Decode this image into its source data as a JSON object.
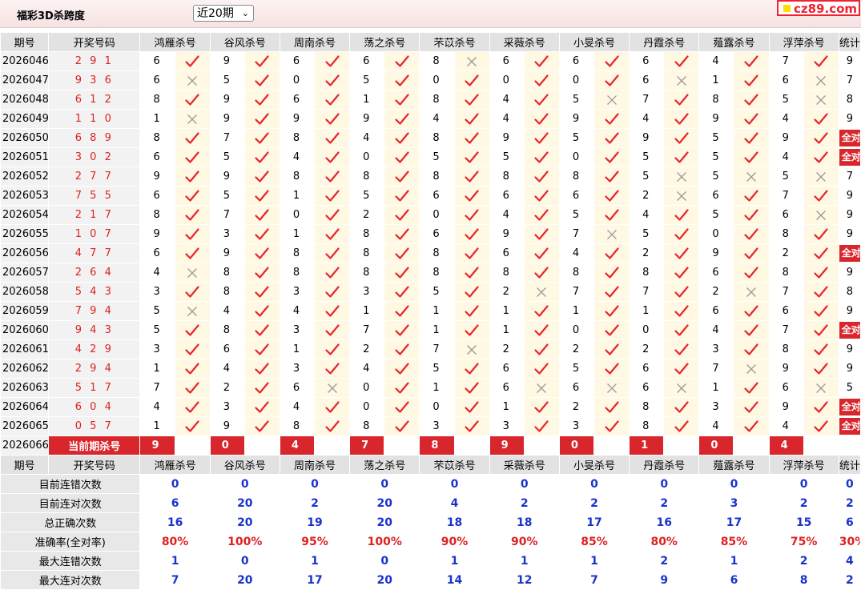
{
  "header": {
    "title": "福彩3D杀跨度",
    "period_select": "近20期",
    "site_logo": "cz89.com"
  },
  "columns": [
    "期号",
    "开奖号码",
    "鸿雁杀号",
    "谷风杀号",
    "周南杀号",
    "荡之杀号",
    "芣苡杀号",
    "采薇杀号",
    "小旻杀号",
    "丹霞杀号",
    "薤露杀号",
    "浮萍杀号",
    "统计"
  ],
  "rows": [
    {
      "issue": "2026046",
      "nums": "2 9 1",
      "k": [
        "6",
        "9",
        "6",
        "6",
        "8",
        "6",
        "6",
        "6",
        "4",
        "7"
      ],
      "m": [
        1,
        1,
        1,
        1,
        0,
        1,
        1,
        1,
        1,
        1
      ],
      "stat": "9"
    },
    {
      "issue": "2026047",
      "nums": "9 3 6",
      "k": [
        "6",
        "5",
        "0",
        "5",
        "0",
        "0",
        "0",
        "6",
        "1",
        "6"
      ],
      "m": [
        0,
        1,
        1,
        1,
        1,
        1,
        1,
        0,
        1,
        0
      ],
      "stat": "7"
    },
    {
      "issue": "2026048",
      "nums": "6 1 2",
      "k": [
        "8",
        "9",
        "6",
        "1",
        "8",
        "4",
        "5",
        "7",
        "8",
        "5"
      ],
      "m": [
        1,
        1,
        1,
        1,
        1,
        1,
        0,
        1,
        1,
        0
      ],
      "stat": "8"
    },
    {
      "issue": "2026049",
      "nums": "1 1 0",
      "k": [
        "1",
        "9",
        "9",
        "9",
        "4",
        "4",
        "9",
        "4",
        "9",
        "4"
      ],
      "m": [
        0,
        1,
        1,
        1,
        1,
        1,
        1,
        1,
        1,
        1
      ],
      "stat": "9"
    },
    {
      "issue": "2026050",
      "nums": "6 8 9",
      "k": [
        "8",
        "7",
        "8",
        "4",
        "8",
        "9",
        "5",
        "9",
        "5",
        "9"
      ],
      "m": [
        1,
        1,
        1,
        1,
        1,
        1,
        1,
        1,
        1,
        1
      ],
      "stat": "全对"
    },
    {
      "issue": "2026051",
      "nums": "3 0 2",
      "k": [
        "6",
        "5",
        "4",
        "0",
        "5",
        "5",
        "0",
        "5",
        "5",
        "4"
      ],
      "m": [
        1,
        1,
        1,
        1,
        1,
        1,
        1,
        1,
        1,
        1
      ],
      "stat": "全对"
    },
    {
      "issue": "2026052",
      "nums": "2 7 7",
      "k": [
        "9",
        "9",
        "8",
        "8",
        "8",
        "8",
        "8",
        "5",
        "5",
        "5"
      ],
      "m": [
        1,
        1,
        1,
        1,
        1,
        1,
        1,
        0,
        0,
        0
      ],
      "stat": "7"
    },
    {
      "issue": "2026053",
      "nums": "7 5 5",
      "k": [
        "6",
        "5",
        "1",
        "5",
        "6",
        "6",
        "6",
        "2",
        "6",
        "7"
      ],
      "m": [
        1,
        1,
        1,
        1,
        1,
        1,
        1,
        0,
        1,
        1
      ],
      "stat": "9"
    },
    {
      "issue": "2026054",
      "nums": "2 1 7",
      "k": [
        "8",
        "7",
        "0",
        "2",
        "0",
        "4",
        "5",
        "4",
        "5",
        "6"
      ],
      "m": [
        1,
        1,
        1,
        1,
        1,
        1,
        1,
        1,
        1,
        0
      ],
      "stat": "9"
    },
    {
      "issue": "2026055",
      "nums": "1 0 7",
      "k": [
        "9",
        "3",
        "1",
        "8",
        "6",
        "9",
        "7",
        "5",
        "0",
        "8"
      ],
      "m": [
        1,
        1,
        1,
        1,
        1,
        1,
        0,
        1,
        1,
        1
      ],
      "stat": "9"
    },
    {
      "issue": "2026056",
      "nums": "4 7 7",
      "k": [
        "6",
        "9",
        "8",
        "8",
        "8",
        "6",
        "4",
        "2",
        "9",
        "2"
      ],
      "m": [
        1,
        1,
        1,
        1,
        1,
        1,
        1,
        1,
        1,
        1
      ],
      "stat": "全对"
    },
    {
      "issue": "2026057",
      "nums": "2 6 4",
      "k": [
        "4",
        "8",
        "8",
        "8",
        "8",
        "8",
        "8",
        "8",
        "6",
        "8"
      ],
      "m": [
        0,
        1,
        1,
        1,
        1,
        1,
        1,
        1,
        1,
        1
      ],
      "stat": "9"
    },
    {
      "issue": "2026058",
      "nums": "5 4 3",
      "k": [
        "3",
        "8",
        "3",
        "3",
        "5",
        "2",
        "7",
        "7",
        "2",
        "7"
      ],
      "m": [
        1,
        1,
        1,
        1,
        1,
        0,
        1,
        1,
        0,
        1
      ],
      "stat": "8"
    },
    {
      "issue": "2026059",
      "nums": "7 9 4",
      "k": [
        "5",
        "4",
        "4",
        "1",
        "1",
        "1",
        "1",
        "1",
        "6",
        "6"
      ],
      "m": [
        0,
        1,
        1,
        1,
        1,
        1,
        1,
        1,
        1,
        1
      ],
      "stat": "9"
    },
    {
      "issue": "2026060",
      "nums": "9 4 3",
      "k": [
        "5",
        "8",
        "3",
        "7",
        "1",
        "1",
        "0",
        "0",
        "4",
        "7"
      ],
      "m": [
        1,
        1,
        1,
        1,
        1,
        1,
        1,
        1,
        1,
        1
      ],
      "stat": "全对"
    },
    {
      "issue": "2026061",
      "nums": "4 2 9",
      "k": [
        "3",
        "6",
        "1",
        "2",
        "7",
        "2",
        "2",
        "2",
        "3",
        "8"
      ],
      "m": [
        1,
        1,
        1,
        1,
        0,
        1,
        1,
        1,
        1,
        1
      ],
      "stat": "9"
    },
    {
      "issue": "2026062",
      "nums": "2 9 4",
      "k": [
        "1",
        "4",
        "3",
        "4",
        "5",
        "6",
        "5",
        "6",
        "7",
        "9"
      ],
      "m": [
        1,
        1,
        1,
        1,
        1,
        1,
        1,
        1,
        0,
        1
      ],
      "stat": "9"
    },
    {
      "issue": "2026063",
      "nums": "5 1 7",
      "k": [
        "7",
        "2",
        "6",
        "0",
        "1",
        "6",
        "6",
        "6",
        "1",
        "6"
      ],
      "m": [
        1,
        1,
        0,
        1,
        1,
        0,
        0,
        0,
        1,
        0
      ],
      "stat": "5"
    },
    {
      "issue": "2026064",
      "nums": "6 0 4",
      "k": [
        "4",
        "3",
        "4",
        "0",
        "0",
        "1",
        "2",
        "8",
        "3",
        "9"
      ],
      "m": [
        1,
        1,
        1,
        1,
        1,
        1,
        1,
        1,
        1,
        1
      ],
      "stat": "全对"
    },
    {
      "issue": "2026065",
      "nums": "0 5 7",
      "k": [
        "1",
        "9",
        "8",
        "8",
        "3",
        "3",
        "3",
        "8",
        "4",
        "4"
      ],
      "m": [
        1,
        1,
        1,
        1,
        1,
        1,
        1,
        1,
        1,
        1
      ],
      "stat": "全对"
    }
  ],
  "current": {
    "issue": "2026066",
    "label": "当前期杀号",
    "k": [
      "9",
      "0",
      "4",
      "7",
      "8",
      "9",
      "0",
      "1",
      "0",
      "4"
    ]
  },
  "summary": [
    {
      "label": "目前连错次数",
      "v": [
        "0",
        "0",
        "0",
        "0",
        "0",
        "0",
        "0",
        "0",
        "0",
        "0",
        "0"
      ],
      "red": false
    },
    {
      "label": "目前连对次数",
      "v": [
        "6",
        "20",
        "2",
        "20",
        "4",
        "2",
        "2",
        "2",
        "3",
        "2",
        "2"
      ],
      "red": false
    },
    {
      "label": "总正确次数",
      "v": [
        "16",
        "20",
        "19",
        "20",
        "18",
        "18",
        "17",
        "16",
        "17",
        "15",
        "6"
      ],
      "red": false
    },
    {
      "label": "准确率(全对率)",
      "v": [
        "80%",
        "100%",
        "95%",
        "100%",
        "90%",
        "90%",
        "85%",
        "80%",
        "85%",
        "75%",
        "30%"
      ],
      "red": true
    },
    {
      "label": "最大连错次数",
      "v": [
        "1",
        "0",
        "1",
        "0",
        "1",
        "1",
        "1",
        "2",
        "1",
        "2",
        "4"
      ],
      "red": false
    },
    {
      "label": "最大连对次数",
      "v": [
        "7",
        "20",
        "17",
        "20",
        "14",
        "12",
        "7",
        "9",
        "6",
        "8",
        "2"
      ],
      "red": false
    }
  ],
  "colors": {
    "accent": "#d8262c",
    "header_bg": "#e2e2e2",
    "mark_bg": "#fff8e3",
    "summary_blue": "#1a33cc"
  },
  "icons": {
    "correct": "check-icon",
    "wrong": "cross-icon"
  }
}
